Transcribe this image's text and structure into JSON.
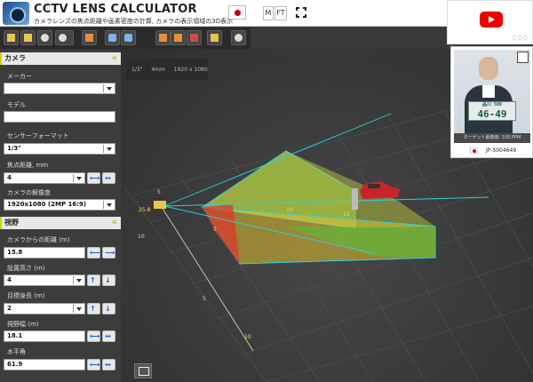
{
  "header": {
    "title": "CCTV LENS CALCULATOR",
    "subtitle": "カメラレンズの焦点距離や画素密度の計算, カメラの表示領域の3D表示",
    "unit_m": "M",
    "unit_ft": "FT"
  },
  "toolbar": {
    "icons": [
      "cube-top-icon",
      "cube-side-icon",
      "camera-icon",
      "3d-view-icon",
      "ruler-icon",
      "zoom-in-icon",
      "zoom-out-icon",
      "add-camera-icon",
      "target-icon",
      "car-icon",
      "grid-icon",
      "share-icon"
    ]
  },
  "camera": {
    "section_title": "カメラ",
    "maker_label": "メーカー",
    "maker_value": "",
    "model_label": "モデル",
    "model_value": "",
    "sensor_label": "センサーフォーマット",
    "sensor_value": "1/3\"",
    "focal_label": "焦点距離, mm",
    "focal_value": "4",
    "resolution_label": "カメラの解像度",
    "resolution_value": "1920x1080 (2MP 16:9)"
  },
  "fov": {
    "section_title": "視野",
    "distance_label": "カメラからの距離 (m)",
    "distance_value": "15.8",
    "height_label": "設置高さ (m)",
    "height_value": "4",
    "target_height_label": "目標身長 (m)",
    "target_height_value": "2",
    "width_label": "視野幅 (m)",
    "width_value": "18.1",
    "angle_label": "水平角",
    "angle_value": "61.9"
  },
  "viewport": {
    "info_sensor": "1/3\"",
    "info_focal": "4mm",
    "info_res": "1920 x 1080",
    "labels": [
      "5",
      "25.8",
      "10",
      "5",
      "10",
      "5",
      "11",
      "10"
    ]
  },
  "target_card": {
    "plate_top": "品川 500",
    "plate_number": "46-49",
    "resolution_text": "ターゲット解像度:   100 PPM",
    "id": "JP-5004649"
  },
  "colors": {
    "accent_yellow": "#d5d200",
    "frustum_green": "#7dd63a",
    "frustum_red": "#d93b2a",
    "line_cyan": "#2ad6e0"
  }
}
